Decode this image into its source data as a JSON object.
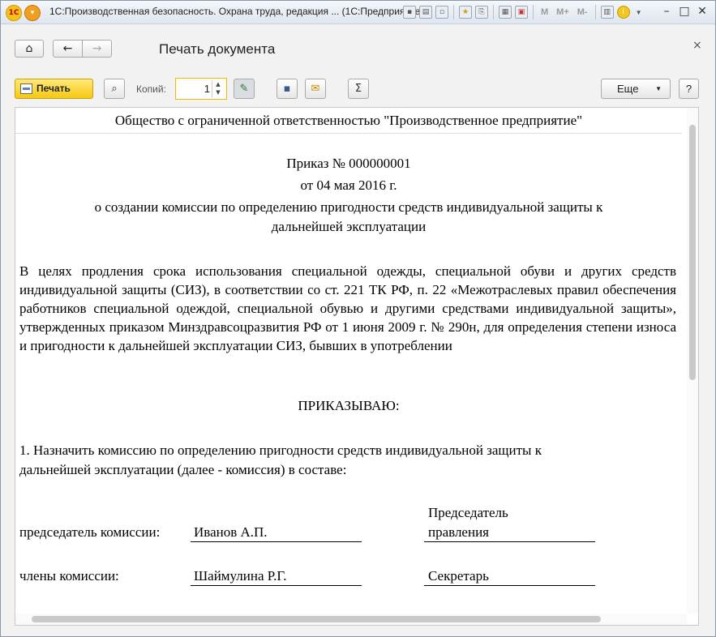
{
  "window": {
    "logo": "1С",
    "title": "1С:Производственная безопасность. Охрана труда, редакция ... (1С:Предприятие)",
    "toolbar_letters": [
      "M",
      "M+",
      "M-"
    ]
  },
  "form": {
    "title": "Печать документа",
    "home_icon": "home-icon",
    "back_icon": "arrow-left-icon",
    "forward_icon": "arrow-right-icon",
    "close_icon": "close-icon"
  },
  "toolbar": {
    "print_label": "Печать",
    "copies_label": "Копий:",
    "copies_value": "1",
    "more_label": "Еще",
    "help_label": "?",
    "sum_label": "Σ"
  },
  "document": {
    "org_name": "Общество с ограниченной ответственностью \"Производственное предприятие\"",
    "order_number": "Приказ № 000000001",
    "order_date": "от 04 мая 2016 г.",
    "subject_line1": "о создании комиссии по определению пригодности средств индивидуальной защиты к",
    "subject_line2": "дальнейшей эксплуатации",
    "preamble": "В целях продления срока использования специальной одежды, специальной обуви и других средств индивидуальной защиты (СИЗ), в соответствии со ст. 221 ТК РФ, п. 22 «Межотраслевых правил обеспечения работников специальной одеждой, специальной обувью и другими средствами индивидуальной защиты», утвержденных приказом Минздравсоцразвития РФ от 1 июня 2009 г. № 290н, для определения степени износа и пригодности к дальнейшей эксплуатации СИЗ, бывших в употреблении",
    "order_word": "ПРИКАЗЫВАЮ:",
    "item1_line1": "1. Назначить комиссию по определению пригодности средств индивидуальной защиты к",
    "item1_line2": "дальнейшей эксплуатации (далее - комиссия) в составе:",
    "chairman_label": "председатель комиссии:",
    "chairman_name": "Иванов А.П.",
    "chairman_position_line1": "Председатель",
    "chairman_position_line2": "правления",
    "members_label": "члены комиссии:",
    "member_name": "Шаймулина Р.Г.",
    "member_position": "Секретарь"
  }
}
